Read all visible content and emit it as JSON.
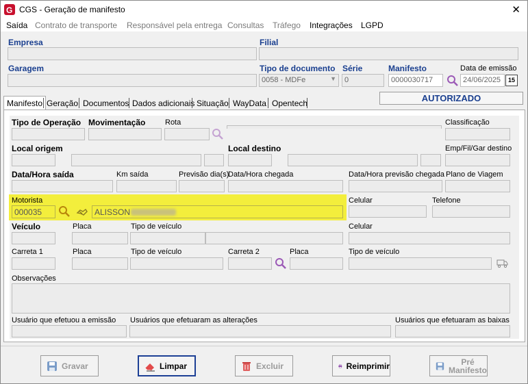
{
  "window": {
    "title": "CGS - Geração de manifesto",
    "close_glyph": "✕"
  },
  "menu": [
    "Saída",
    "Contrato de transporte",
    "Responsável pela entrega",
    "Consultas",
    "Tráfego",
    "Integrações",
    "LGPD"
  ],
  "header": {
    "empresa_label": "Empresa",
    "filial_label": "Filial",
    "garagem_label": "Garagem",
    "tipo_doc_label": "Tipo de documento",
    "tipo_doc_value": "0058 - MDFe",
    "serie_label": "Série",
    "serie_value": "0",
    "manifesto_label": "Manifesto",
    "manifesto_value": "0000030717",
    "data_emissao_label": "Data de emissão",
    "data_emissao_value": "24/06/2025",
    "calendar_glyph": "15"
  },
  "tabs": [
    "Manifesto",
    "Geração",
    "Documentos",
    "Dados adicionais",
    "Situação",
    "WayData",
    "Opentech"
  ],
  "status": "AUTORIZADO",
  "form": {
    "tipo_operacao": "Tipo de Operação",
    "movimentacao": "Movimentação",
    "rota": "Rota",
    "classificacao": "Classificação",
    "local_origem": "Local origem",
    "local_destino": "Local destino",
    "emp_fil_gar": "Emp/Fil/Gar destino",
    "data_hora_saida": "Data/Hora saída",
    "km_saida": "Km saída",
    "previsao_dias": "Previsão dia(s)",
    "data_hora_chegada": "Data/Hora chegada",
    "data_hora_prev_chegada": "Data/Hora previsão chegada",
    "plano_viagem": "Plano de Viagem",
    "motorista": "Motorista",
    "motorista_codigo": "000035",
    "motorista_nome": "ALISSON",
    "celular": "Celular",
    "telefone": "Telefone",
    "veiculo": "Veículo",
    "placa": "Placa",
    "tipo_veiculo": "Tipo de veículo",
    "celular2": "Celular",
    "carreta1": "Carreta 1",
    "placa2": "Placa",
    "tipo_veiculo2": "Tipo de veículo",
    "carreta2": "Carreta 2",
    "placa3": "Placa",
    "tipo_veiculo3": "Tipo de veículo",
    "observacoes": "Observações",
    "usuario_emissao": "Usuário que efetuou a emissão",
    "usuarios_alteracoes": "Usuários que efetuaram as alterações",
    "usuarios_baixas": "Usuários que efetuaram as baixas"
  },
  "buttons": {
    "gravar": "Gravar",
    "limpar": "Limpar",
    "excluir": "Excluir",
    "reimprimir": "Reimprimir",
    "pre_manifesto_1": "Pré",
    "pre_manifesto_2": "Manifesto"
  },
  "colors": {
    "accent": "#1a3f8f",
    "highlight": "#f3ee3c",
    "app_icon": "#c8102e"
  }
}
